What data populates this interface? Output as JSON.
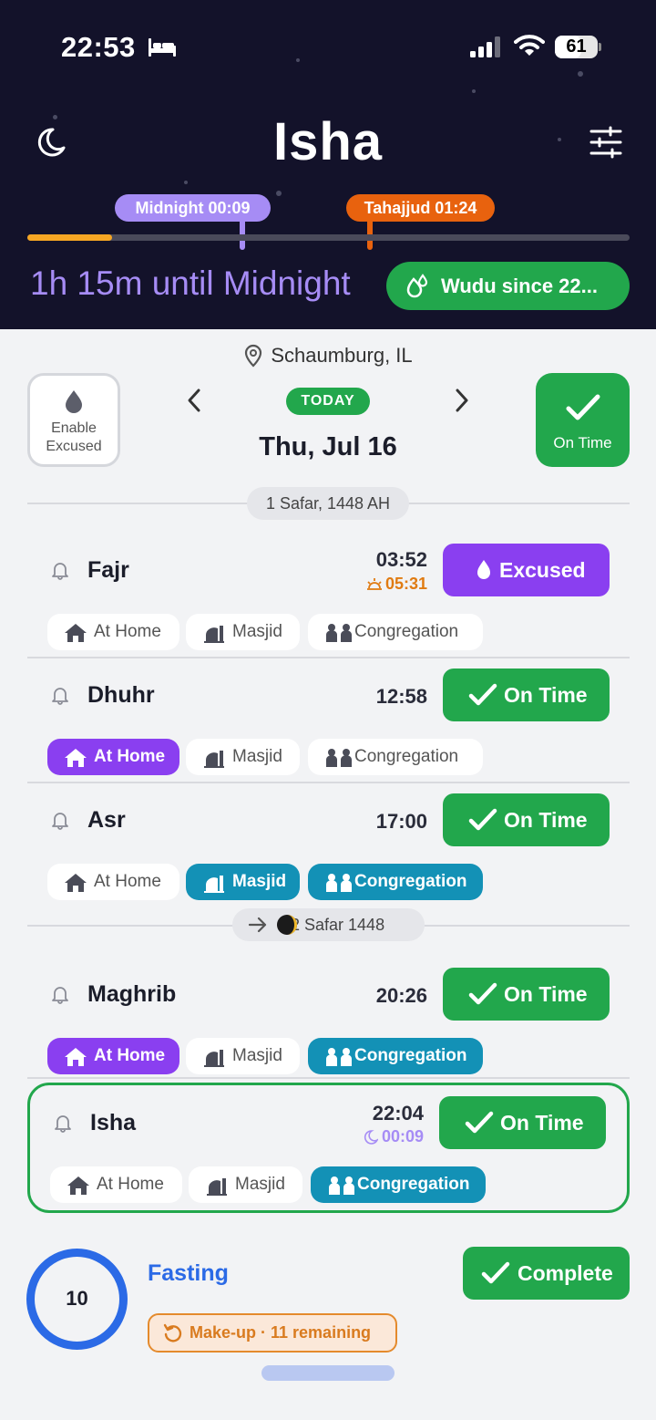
{
  "status_bar": {
    "time": "22:53",
    "battery": "61",
    "battery_level": 0.61
  },
  "header": {
    "title": "Isha",
    "markers": [
      {
        "label": "Midnight 00:09",
        "color": "#a68cf5"
      },
      {
        "label": "Tahajjud 01:24",
        "color": "#e8620e"
      }
    ],
    "progress": 0.14,
    "countdown": "1h 15m until Midnight",
    "wudu_label": "Wudu since 22..."
  },
  "location": "Schaumburg, IL",
  "day_nav": {
    "excused_toggle": [
      "Enable",
      "Excused"
    ],
    "today_badge": "TODAY",
    "date": "Thu, Jul 16",
    "overall_status": "On Time"
  },
  "hijri": {
    "current": "1 Safar, 1448 AH",
    "next": "2 Safar 1448"
  },
  "chip_labels": {
    "home": "At Home",
    "masjid": "Masjid",
    "congregation": "Congregation"
  },
  "prayers": [
    {
      "name": "Fajr",
      "time": "03:52",
      "sub_time": "05:31",
      "sub_icon": "sunrise-icon",
      "status": "Excused",
      "location": "none",
      "congregation": false
    },
    {
      "name": "Dhuhr",
      "time": "12:58",
      "status": "On Time",
      "location": "home",
      "congregation": false
    },
    {
      "name": "Asr",
      "time": "17:00",
      "status": "On Time",
      "location": "masjid",
      "congregation": true
    },
    {
      "name": "Maghrib",
      "time": "20:26",
      "status": "On Time",
      "location": "home",
      "congregation": true
    },
    {
      "name": "Isha",
      "time": "22:04",
      "sub_time": "00:09",
      "sub_icon": "moon-icon",
      "status": "On Time",
      "location": "none",
      "congregation": true
    }
  ],
  "fasting": {
    "count": "10",
    "label": "Fasting",
    "makeup": "Make-up · 11 remaining",
    "status": "Complete"
  },
  "colors": {
    "green": "#22a74c",
    "purple": "#8a3ff0",
    "teal": "#1391b6",
    "blue": "#2b6ae6",
    "orange": "#e48a2c",
    "night": "#13122a"
  }
}
